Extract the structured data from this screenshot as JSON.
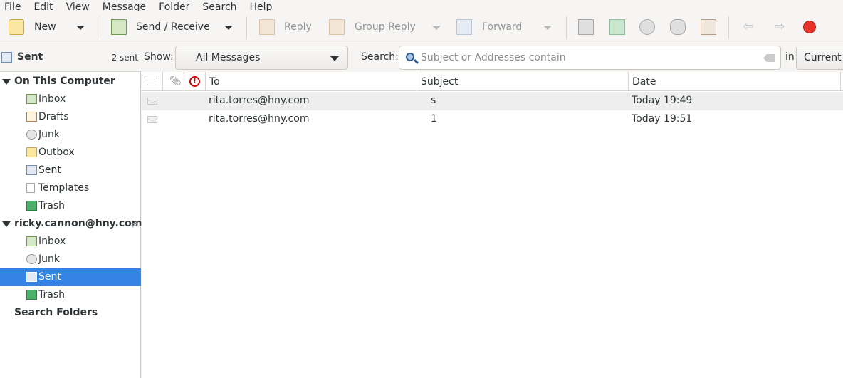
{
  "menubar": {
    "items": [
      "File",
      "Edit",
      "View",
      "Message",
      "Folder",
      "Search",
      "Help"
    ]
  },
  "toolbar": {
    "new_label": "New",
    "send_receive_label": "Send / Receive",
    "reply_label": "Reply",
    "group_reply_label": "Group Reply",
    "forward_label": "Forward"
  },
  "folder_header": {
    "title": "Sent",
    "count": "2 sent"
  },
  "filter": {
    "show_label": "Show:",
    "show_value": "All Messages",
    "search_label": "Search:",
    "search_placeholder": "Subject or Addresses contain",
    "in_label": "in",
    "scope_value": "Current Folder"
  },
  "folders": {
    "local": {
      "name": "On This Computer",
      "items": [
        "Inbox",
        "Drafts",
        "Junk",
        "Outbox",
        "Sent",
        "Templates",
        "Trash"
      ]
    },
    "account": {
      "name": "ricky.cannon@hny.com",
      "items": [
        "Inbox",
        "Junk",
        "Sent",
        "Trash"
      ],
      "selected": "Sent"
    },
    "search_folders": "Search Folders"
  },
  "message_list": {
    "columns": {
      "to": "To",
      "subject": "Subject",
      "date": "Date"
    },
    "rows": [
      {
        "to": "rita.torres@hny.com",
        "subject": "s",
        "date": "Today 19:49"
      },
      {
        "to": "rita.torres@hny.com",
        "subject": "1",
        "date": "Today 19:51"
      }
    ]
  },
  "colors": {
    "selection": "#3584e4",
    "flag_column_icon": "#cc0000"
  }
}
